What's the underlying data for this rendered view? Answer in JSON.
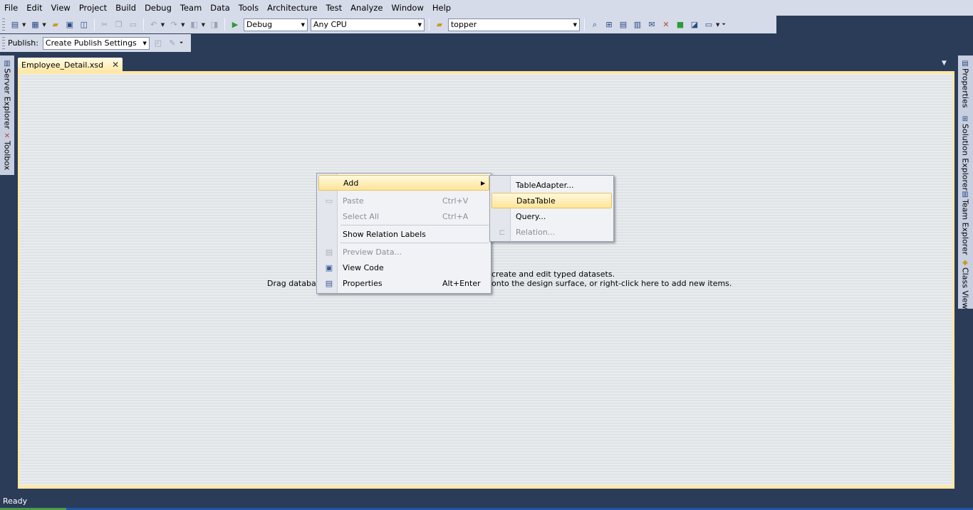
{
  "menu_bar": [
    "File",
    "Edit",
    "View",
    "Project",
    "Build",
    "Debug",
    "Team",
    "Data",
    "Tools",
    "Architecture",
    "Test",
    "Analyze",
    "Window",
    "Help"
  ],
  "toolbar": {
    "config": "Debug",
    "platform": "Any CPU",
    "find": "topper"
  },
  "publish_toolbar": {
    "label": "Publish:",
    "combo": "Create Publish Settings"
  },
  "left_pane": {
    "server_explorer": "Server Explorer",
    "toolbox": "Toolbox"
  },
  "right_pane": {
    "properties": "Properties",
    "solution_explorer": "Solution Explorer",
    "team_explorer": "Team Explorer",
    "class_view": "Class View"
  },
  "document_tab": {
    "title": "Employee_Detail.xsd",
    "close_glyph": "✕"
  },
  "surface_hint": {
    "line1_visible": "create and edit typed datasets.",
    "line2_left": "Drag database",
    "line2_right": "onto the design surface, or right-click here to add new items."
  },
  "context_menu": {
    "items": [
      {
        "label": "Add",
        "shortcut": "",
        "enabled": true,
        "highlighted": true,
        "has_submenu": true
      },
      {
        "label": "Paste",
        "shortcut": "Ctrl+V",
        "enabled": false
      },
      {
        "label": "Select All",
        "shortcut": "Ctrl+A",
        "enabled": false
      },
      {
        "label": "Show Relation Labels",
        "shortcut": "",
        "enabled": true
      },
      {
        "label": "Preview Data...",
        "shortcut": "",
        "enabled": false
      },
      {
        "label": "View Code",
        "shortcut": "",
        "enabled": true
      },
      {
        "label": "Properties",
        "shortcut": "Alt+Enter",
        "enabled": true
      }
    ],
    "submenu_arrow": "▶"
  },
  "submenu": {
    "items": [
      {
        "label": "TableAdapter...",
        "enabled": true
      },
      {
        "label": "DataTable",
        "enabled": true,
        "highlighted": true
      },
      {
        "label": "Query...",
        "enabled": true
      },
      {
        "label": "Relation...",
        "enabled": false
      }
    ]
  },
  "status_bar": {
    "text": "Ready"
  },
  "colors": {
    "chrome": "#d6dbe9",
    "background": "#2b3c59",
    "tab_active": "#ffe8a6",
    "highlight": "#ffe59a"
  }
}
